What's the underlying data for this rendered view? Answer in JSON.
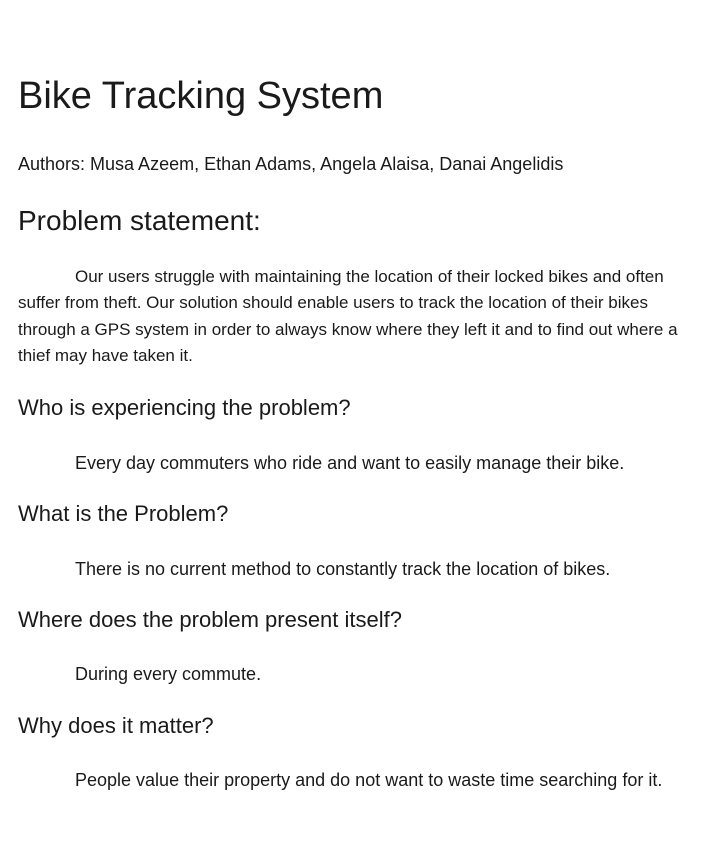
{
  "document": {
    "title": "Bike Tracking System",
    "authors": "Authors: Musa Azeem, Ethan Adams, Angela Alaisa, Danai Angelidis",
    "problem_statement": {
      "heading": "Problem statement:",
      "body": "Our users struggle with maintaining the location of their locked bikes and often suffer from theft. Our solution should enable users to track the location of their bikes through a GPS system in order to always know where they left it and to find out where a thief may have taken it."
    },
    "sections": [
      {
        "question": "Who is experiencing the problem?",
        "answer": "Every day commuters who ride and want to easily manage their bike."
      },
      {
        "question": "What is the Problem?",
        "answer": "There is no current method to constantly track the location of bikes."
      },
      {
        "question": "Where does the problem present itself?",
        "answer": "During every commute."
      },
      {
        "question": "Why does it matter?",
        "answer": "People value their property and do not want to waste time searching for it."
      }
    ]
  }
}
